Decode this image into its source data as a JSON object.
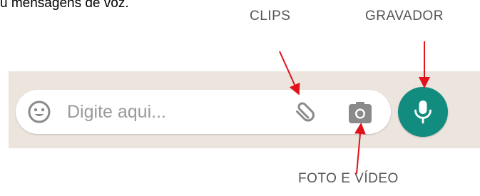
{
  "top_caption": "u mensagens de voz.",
  "callouts": {
    "clips": "CLIPS",
    "gravador": "GRAVADOR",
    "foto_video": "FOTO E VÍDEO"
  },
  "composer": {
    "placeholder": "Digite aqui..."
  },
  "icons": {
    "emoji": "emoji-icon",
    "attach": "paperclip-icon",
    "camera": "camera-icon",
    "mic": "microphone-icon"
  },
  "colors": {
    "accent": "#128c7e",
    "arrow": "#e0121b",
    "background_strip": "#ece5dd",
    "icon_gray": "#8a8a8a"
  }
}
